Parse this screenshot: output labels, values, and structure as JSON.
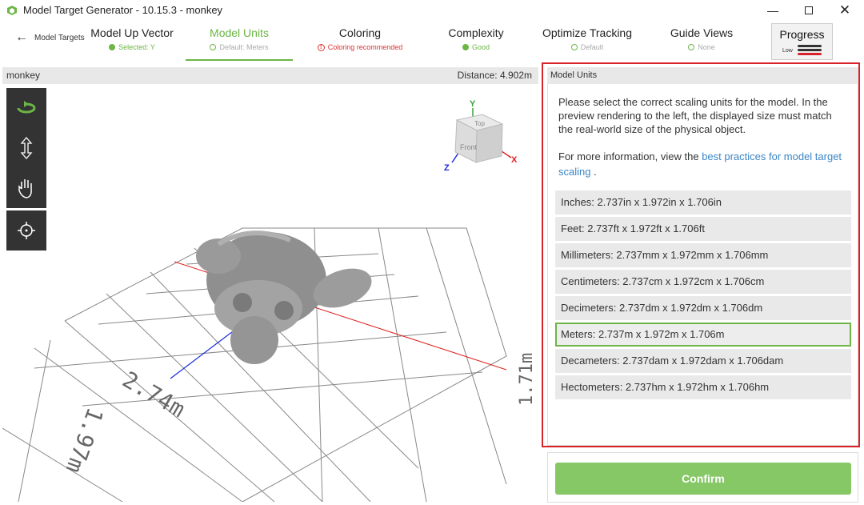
{
  "window": {
    "title": "Model Target Generator - 10.15.3 - monkey",
    "minimize_icon": "minimize-icon",
    "maximize_icon": "maximize-icon",
    "close_icon": "close-icon"
  },
  "nav": {
    "back_label": "Model Targets",
    "tabs": [
      {
        "label": "Model Up Vector",
        "status": "Selected: Y",
        "state": "done"
      },
      {
        "label": "Model Units",
        "status": "Default: Meters",
        "state": "active"
      },
      {
        "label": "Coloring",
        "status": "Coloring recommended",
        "state": "warn"
      },
      {
        "label": "Complexity",
        "status": "Good",
        "state": "done"
      },
      {
        "label": "Optimize Tracking",
        "status": "Default",
        "state": "default"
      },
      {
        "label": "Guide Views",
        "status": "None",
        "state": "default"
      }
    ],
    "progress": {
      "label": "Progress",
      "level_label": "Low",
      "colors": [
        "#333333",
        "#333333",
        "#d9232a"
      ]
    }
  },
  "viewport": {
    "model_name": "monkey",
    "distance": "Distance:  4.902m",
    "axes": {
      "x": "X",
      "y": "Y",
      "z": "Z"
    },
    "cube_faces": {
      "front": "Front",
      "top": "Top"
    },
    "dimension_labels": [
      "2.74m",
      "1.97m",
      "1.71m"
    ],
    "tools": [
      "orbit-icon",
      "vertical-move-icon",
      "pan-hand-icon",
      "focus-target-icon"
    ]
  },
  "panel": {
    "title": "Model Units",
    "description": "Please select the correct scaling units for the model. In the preview rendering to the left, the displayed size must match the real-world size of the physical object.",
    "more_prefix": "For more information, view the ",
    "more_link": "best practices for model target scaling",
    "more_suffix": " .",
    "units": [
      "Inches: 2.737in x 1.972in x 1.706in",
      "Feet: 2.737ft x 1.972ft x 1.706ft",
      "Millimeters: 2.737mm x 1.972mm x 1.706mm",
      "Centimeters: 2.737cm x 1.972cm x 1.706cm",
      "Decimeters: 2.737dm x 1.972dm x 1.706dm",
      "Meters: 2.737m x 1.972m x 1.706m",
      "Decameters: 2.737dam x 1.972dam x 1.706dam",
      "Hectometers: 2.737hm x 1.972hm x 1.706hm"
    ],
    "selected_unit": "Meters: 2.737m x 1.972m x 1.706m",
    "confirm_label": "Confirm"
  },
  "colors": {
    "accent_green": "#6cb546",
    "confirm_green": "#86c766",
    "highlight_red": "#d9232a",
    "link_blue": "#3b86c6"
  }
}
